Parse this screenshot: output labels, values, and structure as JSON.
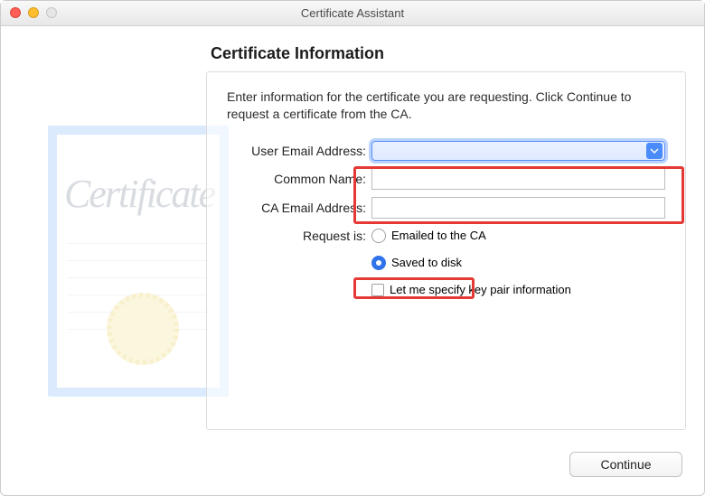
{
  "window": {
    "title": "Certificate Assistant"
  },
  "heading": "Certificate Information",
  "instructions": "Enter information for the certificate you are requesting. Click Continue to request a certificate from the CA.",
  "fields": {
    "userEmail": {
      "label": "User Email Address:",
      "value": ""
    },
    "commonName": {
      "label": "Common Name:",
      "value": ""
    },
    "caEmail": {
      "label": "CA Email Address:",
      "value": ""
    }
  },
  "requestGroup": {
    "label": "Request is:",
    "options": {
      "emailedToCA": {
        "label": "Emailed to the CA",
        "selected": false
      },
      "savedToDisk": {
        "label": "Saved to disk",
        "selected": true
      }
    }
  },
  "checkbox": {
    "label": "Let me specify key pair information",
    "checked": false
  },
  "buttons": {
    "continue": "Continue"
  },
  "decorative": {
    "certificateWord": "Certificate"
  }
}
